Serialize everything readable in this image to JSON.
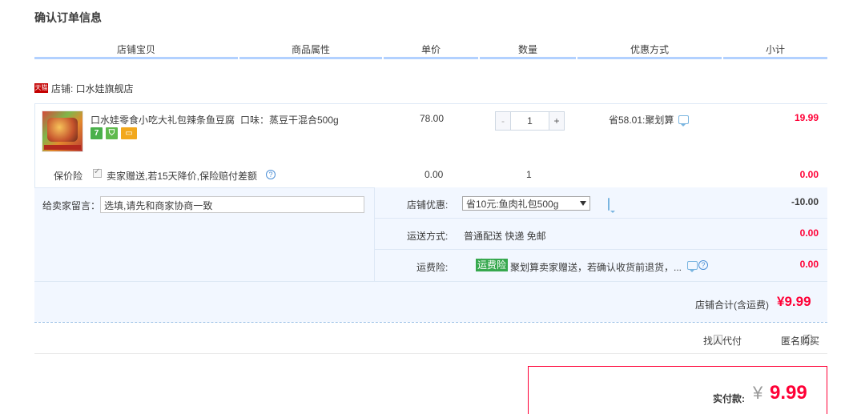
{
  "page_title": "确认订单信息",
  "columns": [
    "店铺宝贝",
    "商品属性",
    "单价",
    "数量",
    "优惠方式",
    "小计"
  ],
  "shop": {
    "badge": "天猫",
    "label": "店铺: 口水娃旗舰店"
  },
  "item": {
    "name": "口水娃零食小吃大礼包辣条鱼豆腐",
    "attribute": "口味：蒸豆干混合500g",
    "price": "78.00",
    "quantity": "1",
    "minus": "-",
    "plus": "+",
    "discount": "省58.01:聚划算",
    "subtotal": "19.99",
    "badges": {
      "b7": "7",
      "b_shield": "⛉",
      "b_card": "▭"
    }
  },
  "insurance": {
    "label": "保价险",
    "text": "卖家赠送,若15天降价,保险赔付差额",
    "price": "0.00",
    "quantity": "1",
    "subtotal": "0.00"
  },
  "memo": {
    "label": "给卖家留言：",
    "value": "选填,请先和商家协商一致"
  },
  "shop_discount": {
    "label": "店铺优惠:",
    "selected": "省10元:鱼肉礼包500g",
    "value": "-10.00"
  },
  "shipping": {
    "label": "运送方式:",
    "value": "普通配送 快递 免邮",
    "price": "0.00"
  },
  "freight_insurance": {
    "label": "运费险:",
    "tag": "运费险",
    "text": "聚划算卖家赠送，若确认收货前退货，...",
    "price": "0.00"
  },
  "shop_total": {
    "label": "店铺合计(含运费)",
    "value": "¥9.99"
  },
  "options": {
    "proxy_pay": "找人代付",
    "anonymous": "匿名购买"
  },
  "pay": {
    "label": "实付款:",
    "yen": "¥",
    "value": "9.99"
  },
  "icons": {
    "help": "?"
  },
  "colors": {
    "price_red": "#ff0036",
    "header_line": "#b2d1ff",
    "panel_bg": "#f2f7ff",
    "tag_green": "#36a84e"
  }
}
